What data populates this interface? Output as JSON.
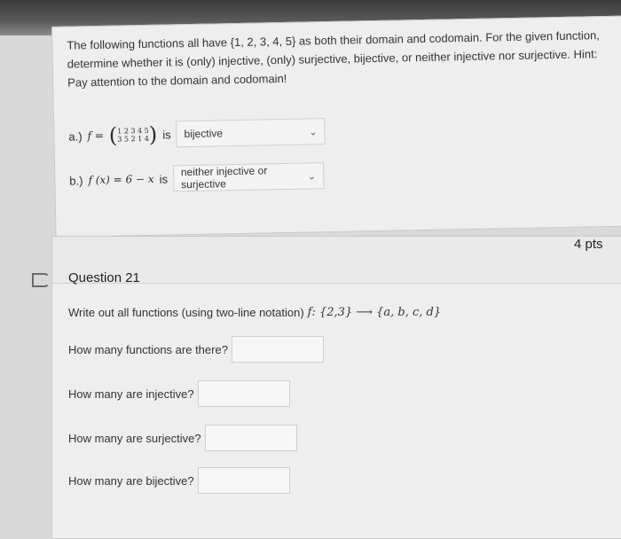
{
  "question_prev": {
    "text_line1": "The following functions all have {1, 2, 3, 4, 5} as both their domain and codomain. For the given function,",
    "text_line2": "determine whether it is (only) injective, (only) surjective, bijective, or neither injective nor surjective. Hint:",
    "text_line3": "Pay attention to the domain and codomain!",
    "part_a": {
      "label": "a.)",
      "f_eq": "f =",
      "top_row": "1 2 3 4 5",
      "bottom_row": "3 5 2 1 4",
      "is_text": "is",
      "selected": "bijective"
    },
    "part_b": {
      "label": "b.)",
      "expr": "f (x) = 6 − x",
      "is_text": "is",
      "selected": "neither injective or surjective"
    }
  },
  "question": {
    "title": "Question 21",
    "points": "4 pts",
    "instruction": "Write out all functions (using two-line notation)",
    "math": "f: {2,3} ⟶ {a, b, c, d}",
    "items": [
      {
        "label": "How many functions are there?",
        "value": ""
      },
      {
        "label": "How many are injective?",
        "value": ""
      },
      {
        "label": "How many are surjective?",
        "value": ""
      },
      {
        "label": "How many are bijective?",
        "value": ""
      }
    ]
  }
}
